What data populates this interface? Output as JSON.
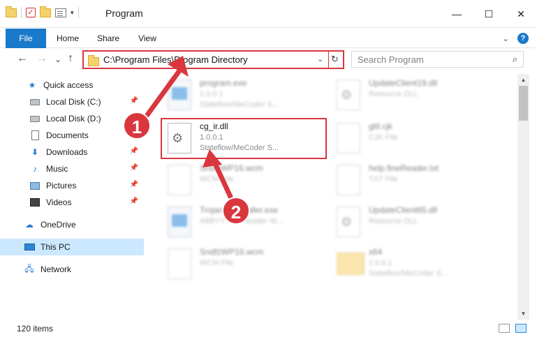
{
  "window": {
    "title": "Program",
    "controls": {
      "minimize": "—",
      "maximize": "☐",
      "close": "✕"
    }
  },
  "ribbon": {
    "tabs": [
      "File",
      "Home",
      "Share",
      "View"
    ],
    "help_icon": "?"
  },
  "nav": {
    "back_icon": "←",
    "forward_icon": "→",
    "recent_icon": "⌄",
    "up_icon": "↑",
    "address": "C:\\Program Files\\Program Directory",
    "refresh_icon": "↻",
    "search_placeholder": "Search Program",
    "search_icon": "⌕"
  },
  "sidebar": {
    "items": [
      {
        "label": "Quick access",
        "icon": "star-icon",
        "pinned": false
      },
      {
        "label": "Local Disk (C:)",
        "icon": "disk-icon",
        "pinned": true
      },
      {
        "label": "Local Disk (D:)",
        "icon": "disk-icon",
        "pinned": false
      },
      {
        "label": "Documents",
        "icon": "document-icon",
        "pinned": true
      },
      {
        "label": "Downloads",
        "icon": "download-icon",
        "pinned": true
      },
      {
        "label": "Music",
        "icon": "music-icon",
        "pinned": true
      },
      {
        "label": "Pictures",
        "icon": "picture-icon",
        "pinned": true
      },
      {
        "label": "Videos",
        "icon": "video-icon",
        "pinned": true
      },
      {
        "label": "OneDrive",
        "icon": "cloud-icon",
        "pinned": false
      },
      {
        "label": "This PC",
        "icon": "computer-icon",
        "selected": true
      },
      {
        "label": "Network",
        "icon": "network-icon",
        "pinned": false
      }
    ]
  },
  "files": [
    {
      "name": "program.exe",
      "line2": "1.0.0.1",
      "line3": "Stateflow/MeCoder S...",
      "type": "exe"
    },
    {
      "name": "UpdateClient19.dll",
      "line2": "Resource DLL",
      "line3": "",
      "type": "dll"
    },
    {
      "name": "cg_ir.dll",
      "line2": "1.0.0.1",
      "line3": "Stateflow/MeCoder S...",
      "type": "dll"
    },
    {
      "name": "gttl.cjk",
      "line2": "CJK File",
      "line3": "",
      "type": "doc"
    },
    {
      "name": "SnsfzWP16.wcm",
      "line2": "WCM File",
      "line3": "",
      "type": "doc"
    },
    {
      "name": "help.fineReader.txt",
      "line2": "TXT File",
      "line3": "",
      "type": "doc"
    },
    {
      "name": "TrojanUninstaller.exe",
      "line2": "ABBYY FineReader W...",
      "line3": "",
      "type": "exe"
    },
    {
      "name": "UpdateClient65.dll",
      "line2": "Resource DLL",
      "line3": "",
      "type": "dll"
    },
    {
      "name": "SndfzWP16.wcm",
      "line2": "WCM File",
      "line3": "",
      "type": "doc"
    },
    {
      "name": "x64",
      "line2": "1.0.0.1",
      "line3": "Stateflow/MeCoder S...",
      "type": "folder"
    }
  ],
  "callouts": [
    "1",
    "2"
  ],
  "status": {
    "item_count": "120 items"
  },
  "colors": {
    "accent": "#1979ca",
    "highlight": "#d9363e",
    "selection": "#cce8ff"
  }
}
